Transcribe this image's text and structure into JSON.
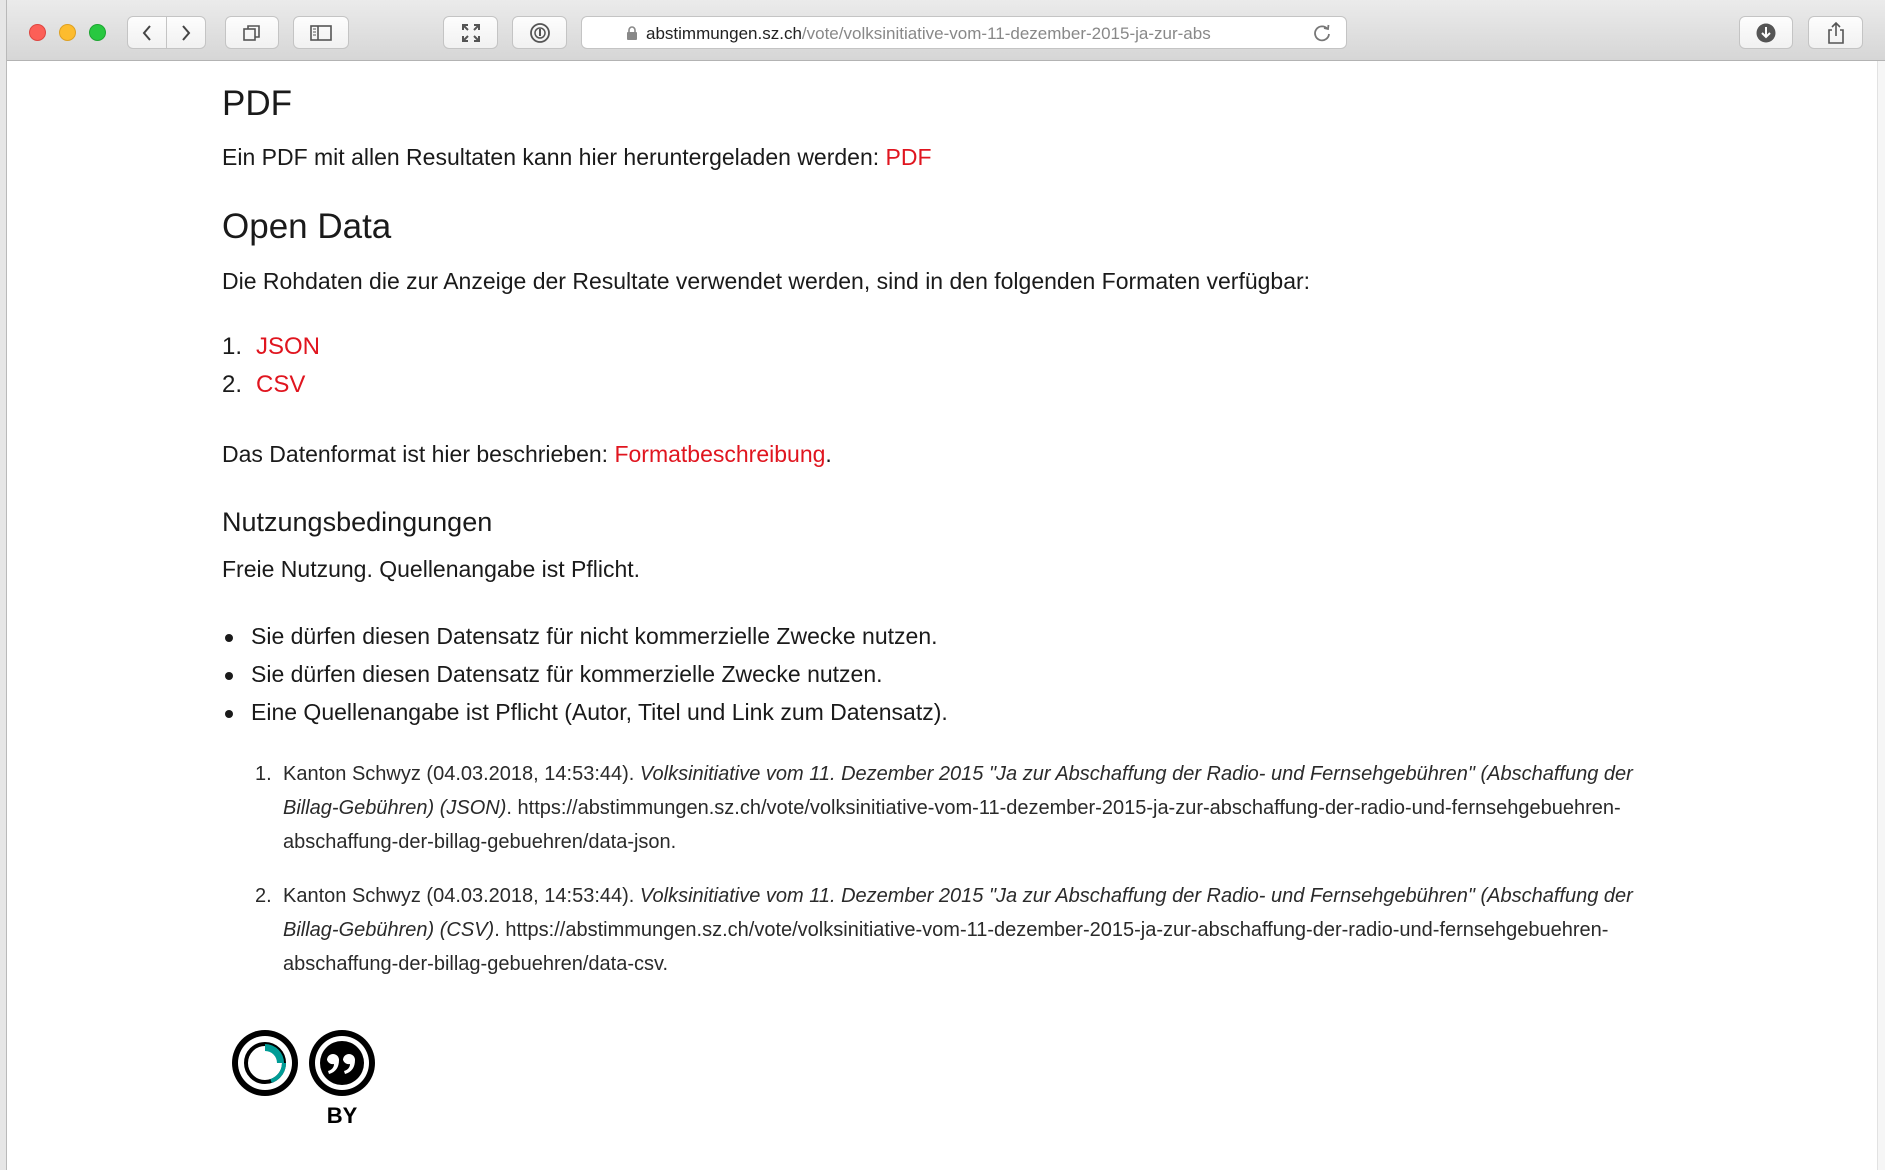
{
  "browser": {
    "url_host": "abstimmungen.sz.ch",
    "url_path": "/vote/volksinitiative-vom-11-dezember-2015-ja-zur-abs"
  },
  "pdf": {
    "heading": "PDF",
    "text": "Ein PDF mit allen Resultaten kann hier heruntergeladen werden: ",
    "link": "PDF"
  },
  "open_data": {
    "heading": "Open Data",
    "text": "Die Rohdaten die zur Anzeige der Resultate verwendet werden, sind in den folgenden Formaten verfügbar:",
    "formats": [
      {
        "num": "1.",
        "label": "JSON"
      },
      {
        "num": "2.",
        "label": "CSV"
      }
    ],
    "format_text": "Das Datenformat ist hier beschrieben: ",
    "format_link": "Formatbeschreibung",
    "format_end": "."
  },
  "terms": {
    "heading": "Nutzungsbedingungen",
    "text": "Freie Nutzung. Quellenangabe ist Pflicht.",
    "bullets": [
      "Sie dürfen diesen Datensatz für nicht kommerzielle Zwecke nutzen.",
      "Sie dürfen diesen Datensatz für kommerzielle Zwecke nutzen.",
      "Eine Quellenangabe ist Pflicht (Autor, Titel und Link zum Datensatz)."
    ],
    "citations": [
      {
        "num": "1.",
        "author": "Kanton Schwyz (04.03.2018, 14:53:44). ",
        "title": "Volksinitiative vom 11. Dezember 2015 \"Ja zur Abschaffung der Radio- und Fernsehgebühren\" (Abschaffung der Billag-Gebühren) (JSON)",
        "url": ". https://abstimmungen.sz.ch/vote/volksinitiative-vom-11-dezember-2015-ja-zur-abschaffung-der-radio-und-fernsehgebuehren-abschaffung-der-billag-gebuehren/data-json."
      },
      {
        "num": "2.",
        "author": "Kanton Schwyz (04.03.2018, 14:53:44). ",
        "title": "Volksinitiative vom 11. Dezember 2015 \"Ja zur Abschaffung der Radio- und Fernsehgebühren\" (Abschaffung der Billag-Gebühren) (CSV)",
        "url": ". https://abstimmungen.sz.ch/vote/volksinitiative-vom-11-dezember-2015-ja-zur-abschaffung-der-radio-und-fernsehgebuehren-abschaffung-der-billag-gebuehren/data-csv."
      }
    ],
    "license_label": "BY"
  },
  "colors": {
    "link": "#e0151f",
    "cc_accent": "#009c96"
  }
}
